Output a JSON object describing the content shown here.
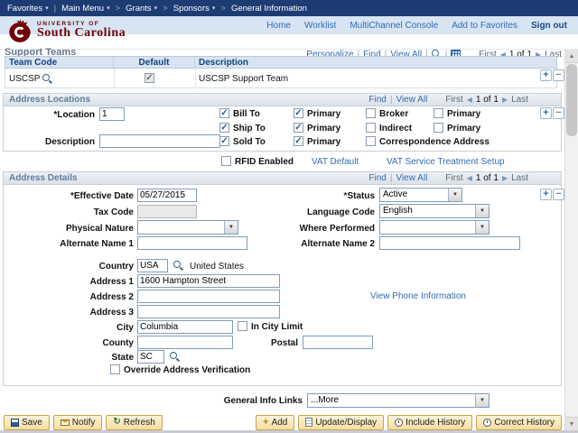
{
  "ui": {
    "pipe": "|",
    "crumb_sep": ">"
  },
  "glyphs": {
    "caret": "▾",
    "prev": "◀",
    "next": "▶",
    "select": "▼",
    "scroll_up": "▲",
    "scroll_down": "▼",
    "plus": "+",
    "minus": "−",
    "refresh": "↻"
  },
  "breadcrumb": {
    "items": [
      {
        "label": "Favorites"
      },
      {
        "label": "Main Menu"
      },
      {
        "label": "Grants"
      },
      {
        "label": "Sponsors"
      },
      {
        "label": "General Information"
      }
    ]
  },
  "header": {
    "university_line1": "UNIVERSITY OF",
    "university_line2": "South Carolina",
    "links": [
      "Home",
      "Worklist",
      "MultiChannel Console",
      "Add to Favorites"
    ],
    "signout": "Sign out"
  },
  "support_teams": {
    "title": "Support Teams",
    "toolbar": {
      "personalize": "Personalize",
      "find": "Find",
      "view_all": "View All",
      "first": "First",
      "page": "1 of 1",
      "last": "Last"
    },
    "columns": {
      "team_code": "Team Code",
      "default": "Default",
      "description": "Description"
    },
    "row": {
      "team_code": "USCSP",
      "default_checked": true,
      "description": "USCSP Support Team"
    }
  },
  "address_locations": {
    "title": "Address Locations",
    "nav": {
      "find": "Find",
      "view_all": "View All",
      "first": "First",
      "page": "1 of 1",
      "last": "Last"
    },
    "location": {
      "label": "*Location",
      "value": "1"
    },
    "description": {
      "label": "Description",
      "value": ""
    },
    "checks": {
      "bill_to": {
        "label": "Bill To",
        "checked": true
      },
      "bill_primary": {
        "label": "Primary",
        "checked": true
      },
      "broker": {
        "label": "Broker",
        "checked": false
      },
      "broker_primary": {
        "label": "Primary",
        "checked": false
      },
      "ship_to": {
        "label": "Ship To",
        "checked": true
      },
      "ship_primary": {
        "label": "Primary",
        "checked": true
      },
      "indirect": {
        "label": "Indirect",
        "checked": false
      },
      "indirect_primary": {
        "label": "Primary",
        "checked": false
      },
      "sold_to": {
        "label": "Sold To",
        "checked": true
      },
      "sold_primary": {
        "label": "Primary",
        "checked": true
      },
      "correspondence": {
        "label": "Correspondence Address",
        "checked": false
      },
      "rfid": {
        "label": "RFID Enabled",
        "checked": false
      }
    },
    "links": {
      "vat_default": "VAT Default",
      "vat_service": "VAT Service Treatment Setup"
    }
  },
  "address_details": {
    "title": "Address Details",
    "nav": {
      "find": "Find",
      "view_all": "View All",
      "first": "First",
      "page": "1 of 1",
      "last": "Last"
    },
    "fields": {
      "effective_date": {
        "label": "*Effective Date",
        "value": "05/27/2015"
      },
      "status": {
        "label": "*Status",
        "value": "Active"
      },
      "tax_code": {
        "label": "Tax Code",
        "value": ""
      },
      "language_code": {
        "label": "Language Code",
        "value": "English"
      },
      "physical_nature": {
        "label": "Physical Nature",
        "value": ""
      },
      "where_performed": {
        "label": "Where Performed",
        "value": ""
      },
      "alternate_name_1": {
        "label": "Alternate Name 1",
        "value": ""
      },
      "alternate_name_2": {
        "label": "Alternate Name 2",
        "value": ""
      },
      "country": {
        "label": "Country",
        "value": "USA",
        "display": "United States"
      },
      "address_1": {
        "label": "Address 1",
        "value": "1600 Hampton Street"
      },
      "address_2": {
        "label": "Address 2",
        "value": ""
      },
      "address_3": {
        "label": "Address 3",
        "value": ""
      },
      "city": {
        "label": "City",
        "value": "Columbia"
      },
      "in_city_limit": {
        "label": "In City Limit",
        "checked": false
      },
      "county": {
        "label": "County",
        "value": ""
      },
      "postal": {
        "label": "Postal",
        "value": ""
      },
      "state": {
        "label": "State",
        "value": "SC"
      },
      "override": {
        "label": "Override Address Verification",
        "checked": false
      }
    },
    "view_phone_link": "View Phone Information"
  },
  "general_info": {
    "label": "General Info Links",
    "value": "...More"
  },
  "footer": {
    "save": "Save",
    "notify": "Notify",
    "refresh": "Refresh",
    "add": "Add",
    "update_display": "Update/Display",
    "include_history": "Include History",
    "correct_history": "Correct History"
  }
}
